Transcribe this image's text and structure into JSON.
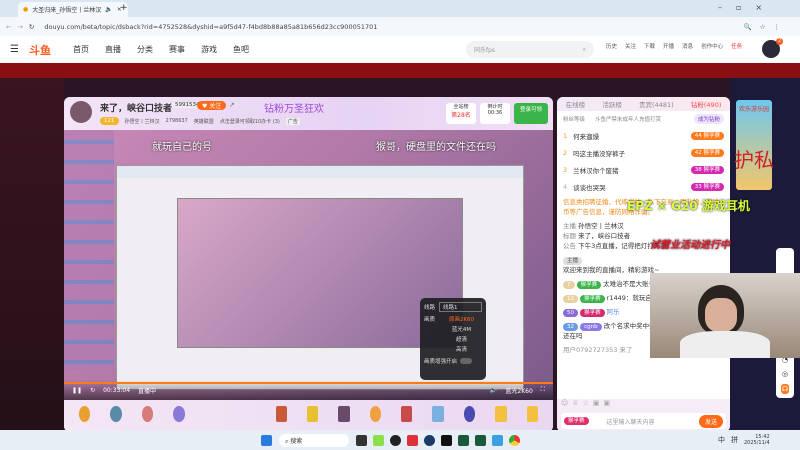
{
  "browser": {
    "tab_title": "大圣归来_孙悟空丨兰林汉",
    "url": "douyu.com/beta/topic/dsback?rid=4752528&dyshid=a9f5d47-f4bd8b88a85a81b656d23cc900051701",
    "new_tab": "+"
  },
  "site": {
    "logo": "斗鱼",
    "nav": [
      "首页",
      "直播",
      "分类",
      "赛事",
      "游戏",
      "鱼吧"
    ],
    "search_placeholder": "同乐fps",
    "toolbar": [
      "历史",
      "关注",
      "下载",
      "开播",
      "消息",
      "创作中心",
      "任务"
    ],
    "avatar_badge": "2"
  },
  "stream": {
    "title": "来了，峡谷口技者",
    "room_id": "5991534",
    "follow_label": "关注",
    "level": "121",
    "streamer": "孙悟空丨兰林汉",
    "heat": "2798637",
    "category": "英雄联盟",
    "promo": "点击登录可领取10办卡 (3)",
    "ad_label": "广告",
    "event_banner": "钻粉万圣狂欢",
    "rank_label": "全站榜",
    "rank_value": "第28名",
    "timer_label": "倒计时",
    "timer_value": "00:36",
    "login_reward": "登录可领"
  },
  "video": {
    "subtitle_left": "就玩自己的号",
    "subtitle_right": "猴哥，硬盘里的文件还在吗",
    "time": "00:33:04",
    "live_label": "直播中",
    "quality": "蓝光2K60"
  },
  "quality_menu": {
    "line_label": "线路",
    "line_value": "线路1",
    "quality_label": "画质",
    "options": [
      "原画2K60",
      "蓝光4M",
      "超清",
      "高清"
    ],
    "hdr_label": "画质增强开启"
  },
  "chat": {
    "tabs": [
      "在线榜",
      "活跃榜",
      "贵宾(4481)",
      "钻粉(490)"
    ],
    "fan_level": "粉丝等级",
    "notice_minor": "斗鱼严禁未成年人充值打赏",
    "become_fan": "成为钻粉",
    "rank": [
      {
        "n": "1",
        "name": "何来遛燥"
      },
      {
        "n": "2",
        "name": "吗这主播没穿裤子"
      },
      {
        "n": "3",
        "name": "兰林汉你个废猪"
      },
      {
        "n": "4",
        "name": "谈谈也哭哭"
      }
    ],
    "rank_levels": [
      "44",
      "42",
      "38",
      "33"
    ],
    "rank_badge": "猴孚赛",
    "warning": "信息类招聘征婚、代练代抽、私下交易、刷礼物、游戏币等广告信息，谨防网络诈骗。",
    "info": [
      {
        "k": "主播",
        "v": "孙悟空丨兰林汉"
      },
      {
        "k": "标题",
        "v": "来了，峡谷口技者"
      },
      {
        "k": "公告",
        "v": "下午3点直播，记得把灯打开哦！"
      }
    ],
    "host_tag": "主播",
    "welcome": "欢迎来到我的直播间，精彩游戏~",
    "messages": [
      {
        "lvl": "7",
        "badge": "猴孚赛",
        "text": "太难治不是大账号你自己选人上啊"
      },
      {
        "lvl": "10",
        "badge": "猴孚赛",
        "text": "r1449：就玩自己的号"
      },
      {
        "lvl": "50",
        "badge": "猴孚赛",
        "text": "阿乐"
      },
      {
        "lvl": "32",
        "badge": "cgnb",
        "text": "改个名求中奖中奖：猴哥，硬盘里的文件还在吗"
      }
    ],
    "join": "用户0792727353 来了",
    "input_placeholder": "这里输入聊天内容",
    "send": "发送"
  },
  "ads": {
    "ad1": "欢乐游乐园",
    "ad2": "EPZ × G20 游戏耳机",
    "ad3": "试营业活动进行中",
    "overlay": "护私"
  },
  "taskbar": {
    "search": "搜索",
    "time": "15:42",
    "date": "2025/11/4",
    "ime": "中",
    "ime2": "拼"
  },
  "colors": {
    "brand": "#ff5d23",
    "banner": "#8a0f12",
    "fan": "#ff4d4f"
  }
}
